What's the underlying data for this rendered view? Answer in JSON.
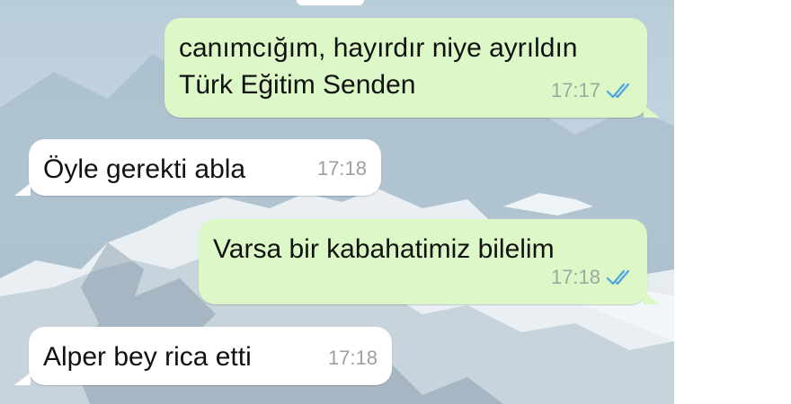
{
  "messages": [
    {
      "direction": "outgoing",
      "lines": [
        "canımcığım, hayırdır niye ayrıldın",
        "Türk Eğitim Senden"
      ],
      "time": "17:17",
      "status": "read",
      "tick_color": "#4fa3e0"
    },
    {
      "direction": "incoming",
      "lines": [
        "Öyle gerekti abla"
      ],
      "time": "17:18"
    },
    {
      "direction": "outgoing",
      "lines": [
        "Varsa bir kabahatimiz bilelim"
      ],
      "time": "17:18",
      "status": "read",
      "tick_color": "#4fa3e0"
    },
    {
      "direction": "incoming",
      "lines": [
        "Alper bey rica etti"
      ],
      "time": "17:18"
    }
  ],
  "colors": {
    "outgoing_bubble": "#dcf8c6",
    "incoming_bubble": "#ffffff",
    "read_ticks": "#4fa3e0"
  },
  "icons": {
    "read_receipt": "double-check-icon"
  }
}
